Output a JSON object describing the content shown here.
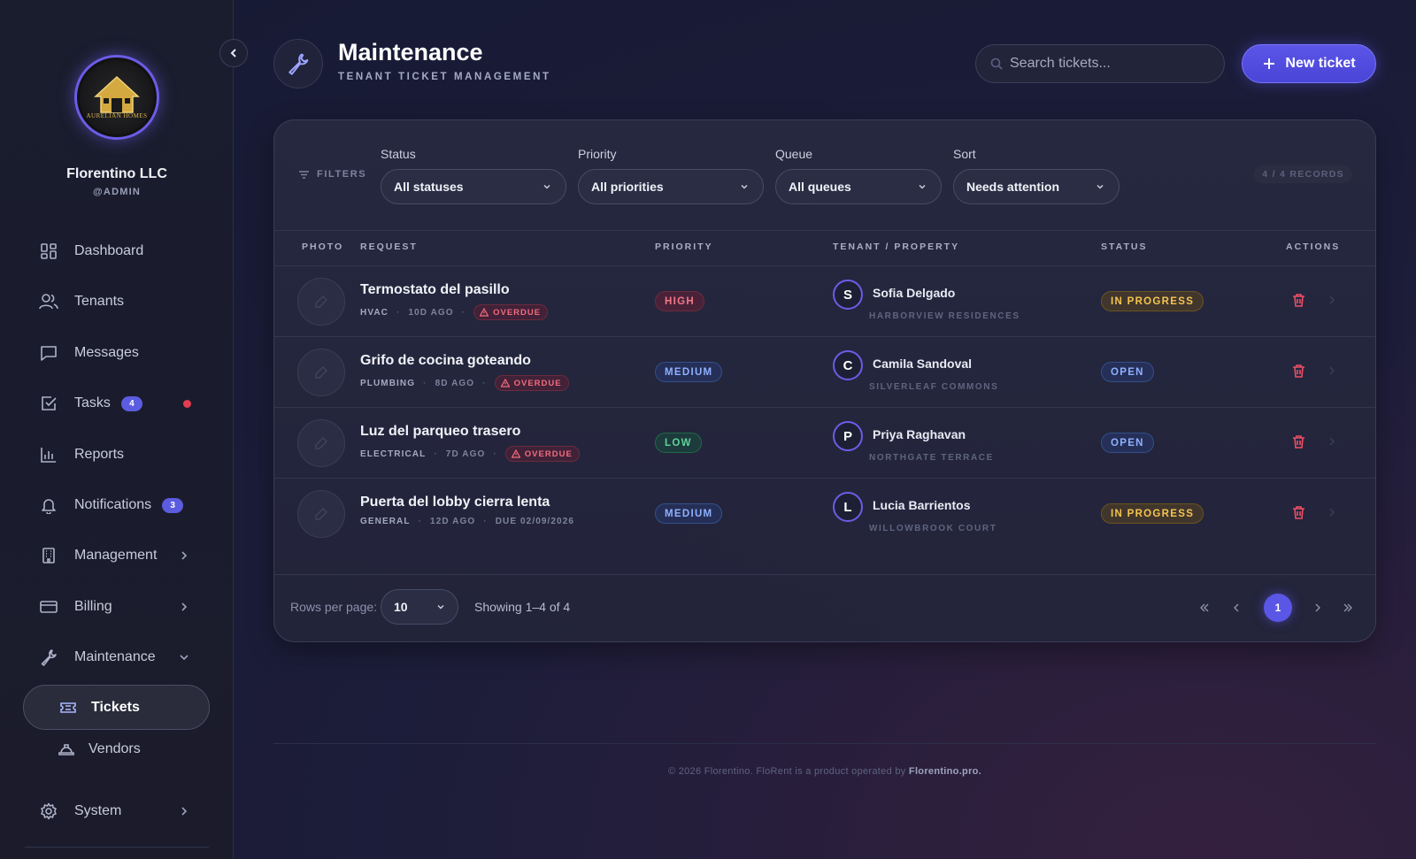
{
  "sidebar": {
    "logo_text": "AURELIAN HOMES",
    "logo_sub": "LUXURY",
    "org_name": "Florentino LLC",
    "org_role": "@ADMIN",
    "items": [
      {
        "label": "Dashboard",
        "icon": "grid-icon"
      },
      {
        "label": "Tenants",
        "icon": "users-icon"
      },
      {
        "label": "Messages",
        "icon": "message-icon"
      },
      {
        "label": "Tasks",
        "icon": "checkbox-icon",
        "badge": "4"
      },
      {
        "label": "Reports",
        "icon": "bar-chart-icon"
      },
      {
        "label": "Notifications",
        "icon": "bell-icon",
        "badge": "3"
      },
      {
        "label": "Management",
        "icon": "building-icon"
      },
      {
        "label": "Billing",
        "icon": "credit-card-icon"
      },
      {
        "label": "Maintenance",
        "icon": "wrench-icon"
      },
      {
        "label": "System",
        "icon": "gear-icon"
      }
    ],
    "sub_items": [
      {
        "label": "Tickets",
        "icon": "ticket-icon",
        "active": true
      },
      {
        "label": "Vendors",
        "icon": "hardhat-icon"
      }
    ]
  },
  "header": {
    "title": "Maintenance",
    "subtitle": "TENANT TICKET MANAGEMENT",
    "search_placeholder": "Search tickets...",
    "new_button": "New ticket"
  },
  "filters": {
    "label": "FILTERS",
    "status": {
      "label": "Status",
      "value": "All statuses"
    },
    "priority": {
      "label": "Priority",
      "value": "All priorities"
    },
    "queue": {
      "label": "Queue",
      "value": "All queues"
    },
    "sort": {
      "label": "Sort",
      "value": "Needs attention"
    },
    "records": "4 / 4 RECORDS"
  },
  "table": {
    "columns": {
      "photo": "PHOTO",
      "request": "REQUEST",
      "priority": "PRIORITY",
      "tenant": "TENANT / PROPERTY",
      "status": "STATUS",
      "actions": "ACTIONS"
    },
    "rows": [
      {
        "title": "Termostato del pasillo",
        "category": "HVAC",
        "age": "10D AGO",
        "flag": "OVERDUE",
        "priority": "HIGH",
        "tenant_initial": "S",
        "tenant": "Sofia Delgado",
        "property": "HARBORVIEW RESIDENCES",
        "status": "IN PROGRESS"
      },
      {
        "title": "Grifo de cocina goteando",
        "category": "PLUMBING",
        "age": "8D AGO",
        "flag": "OVERDUE",
        "priority": "MEDIUM",
        "tenant_initial": "C",
        "tenant": "Camila Sandoval",
        "property": "SILVERLEAF COMMONS",
        "status": "OPEN"
      },
      {
        "title": "Luz del parqueo trasero",
        "category": "ELECTRICAL",
        "age": "7D AGO",
        "flag": "OVERDUE",
        "priority": "LOW",
        "tenant_initial": "P",
        "tenant": "Priya Raghavan",
        "property": "NORTHGATE TERRACE",
        "status": "OPEN"
      },
      {
        "title": "Puerta del lobby cierra lenta",
        "category": "GENERAL",
        "age": "12D AGO",
        "due": "DUE 02/09/2026",
        "priority": "MEDIUM",
        "tenant_initial": "L",
        "tenant": "Lucia Barrientos",
        "property": "WILLOWBROOK COURT",
        "status": "IN PROGRESS"
      }
    ]
  },
  "pagination": {
    "rows_label": "Rows per page:",
    "rows_value": "10",
    "showing": "Showing 1–4 of 4",
    "current_page": "1"
  },
  "footer": {
    "text": "© 2026 Florentino. FloRent is a product operated by",
    "brand": "Florentino.pro."
  },
  "colors": {
    "accent": "#5b55e8",
    "high": "#f0788a",
    "medium": "#8fb0ff",
    "low": "#5fd39a",
    "in_progress": "#f5c451",
    "open": "#8fb0ff",
    "danger": "#ec4f64"
  }
}
